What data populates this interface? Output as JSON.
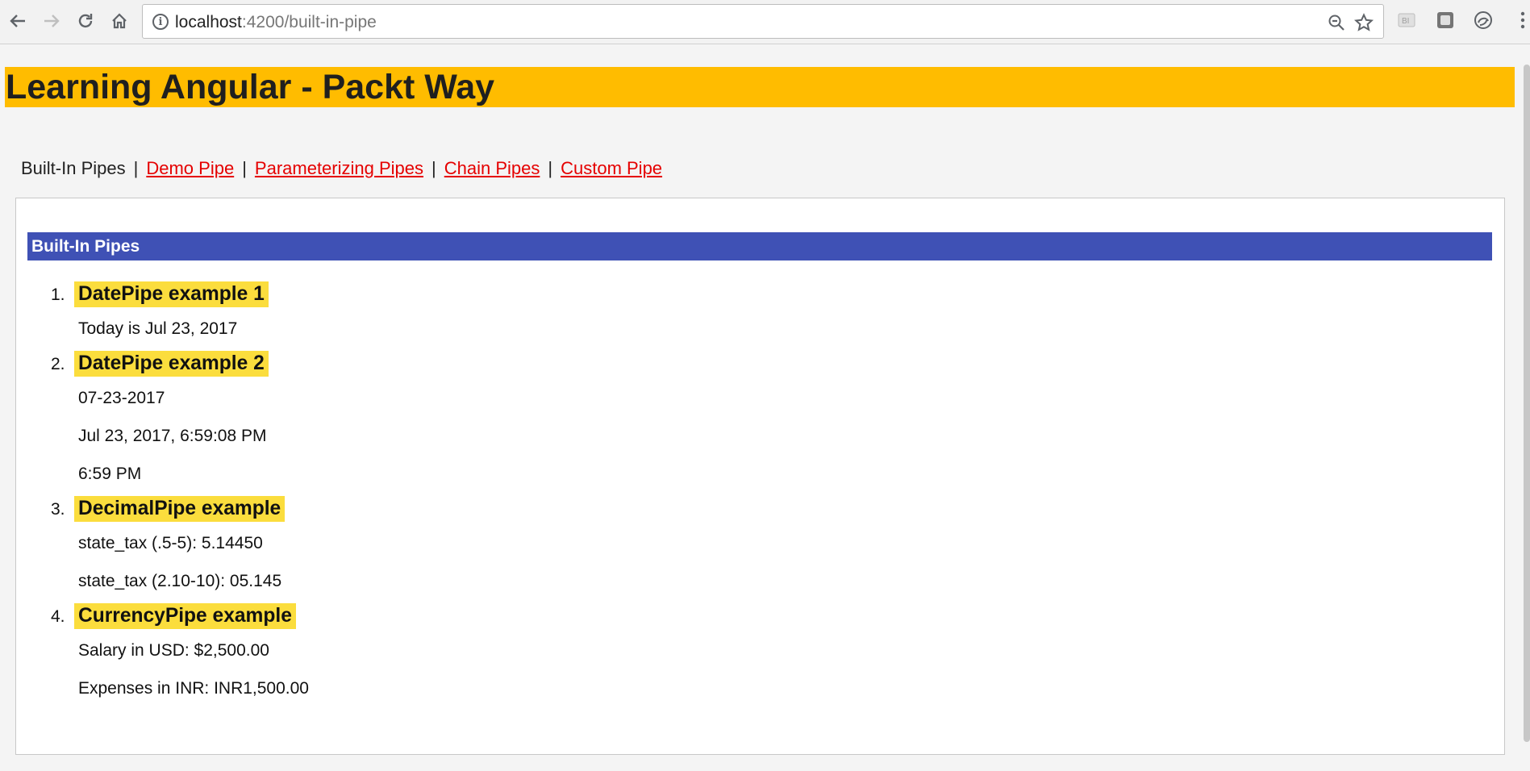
{
  "browser": {
    "url_host": "localhost",
    "url_port_path": ":4200/built-in-pipe",
    "icons": {
      "back": "arrow-left-icon",
      "forward": "arrow-right-icon",
      "reload": "reload-icon",
      "home": "home-icon",
      "info": "info-icon",
      "zoom": "zoom-out-icon",
      "bookmark": "star-icon",
      "menu": "more-vertical-icon"
    }
  },
  "app": {
    "title": "Learning Angular - Packt Way"
  },
  "nav": {
    "current": "Built-In Pipes",
    "separator": "|",
    "links": [
      "Demo Pipe",
      "Parameterizing Pipes",
      "Chain Pipes",
      "Custom Pipe"
    ]
  },
  "section": {
    "header": "Built-In Pipes",
    "items": [
      {
        "number": "1.",
        "title": "DatePipe example 1",
        "lines": [
          "Today is Jul 23, 2017"
        ]
      },
      {
        "number": "2.",
        "title": "DatePipe example 2",
        "lines": [
          "07-23-2017",
          "Jul 23, 2017, 6:59:08 PM",
          "6:59 PM"
        ]
      },
      {
        "number": "3.",
        "title": "DecimalPipe example",
        "lines": [
          "state_tax (.5-5): 5.14450",
          "state_tax (2.10-10): 05.145"
        ]
      },
      {
        "number": "4.",
        "title": "CurrencyPipe example",
        "lines": [
          "Salary in USD: $2,500.00",
          "Expenses in INR: INR1,500.00"
        ]
      }
    ]
  },
  "colors": {
    "title_bar": "#ffbc00",
    "section_header": "#3f51b5",
    "highlight": "#fbdd3d",
    "link": "#e50000"
  }
}
